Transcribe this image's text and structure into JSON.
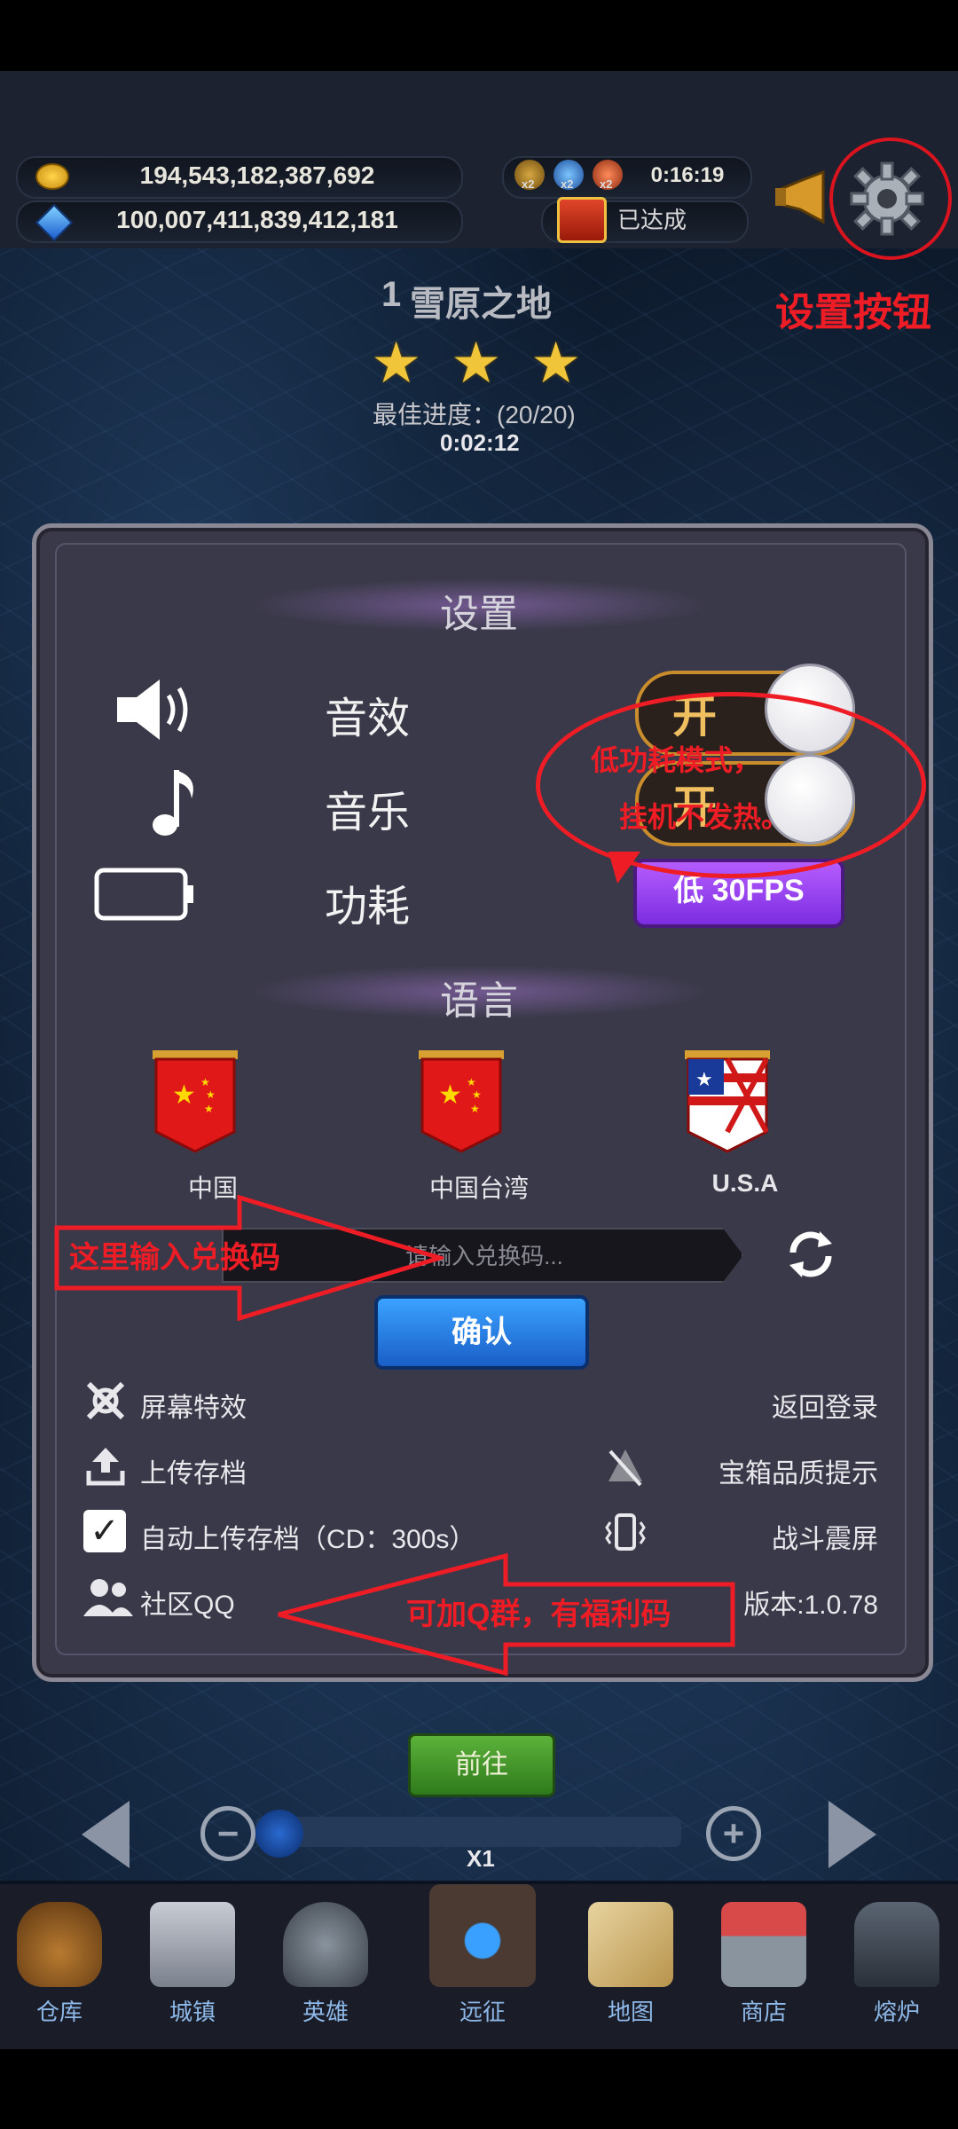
{
  "resources": {
    "gold": "194,543,182,387,692",
    "gems": "100,007,411,839,412,181"
  },
  "boosts": {
    "multipliers": [
      "x2",
      "x2",
      "x2"
    ],
    "timer": "0:16:19",
    "achievement": "已达成"
  },
  "annotations": {
    "settings_button": "设置按钮",
    "low_power": [
      "低功耗模式，",
      "挂机不发热。"
    ],
    "redeem_here": "这里输入兑换码",
    "qq_group": "可加Q群，有福利码"
  },
  "stage": {
    "number": "1",
    "name": "雪原之地",
    "best_progress": "最佳进度：(20/20)",
    "best_time": "0:02:12",
    "stars": 3
  },
  "settings": {
    "title": "设置",
    "sound_label": "音效",
    "sound_state": "开",
    "music_label": "音乐",
    "music_state": "开",
    "power_label": "功耗",
    "power_button": "低 30FPS",
    "language_title": "语言",
    "languages": [
      "中国",
      "中国台湾",
      "U.S.A"
    ],
    "redeem_placeholder": "请输入兑换码...",
    "confirm": "确认",
    "options_left": {
      "screen_effects": "屏幕特效",
      "upload_save": "上传存档",
      "auto_upload": "自动上传存档（CD：300s）",
      "community": "社区QQ"
    },
    "options_right": {
      "back_to_login": "返回登录",
      "chest_quality": "宝箱品质提示",
      "battle_shake": "战斗震屏",
      "version": "版本:1.0.78"
    }
  },
  "bottom": {
    "go_button": "前往",
    "speed": "X1",
    "nav": [
      "仓库",
      "城镇",
      "英雄",
      "远征",
      "地图",
      "商店",
      "熔炉"
    ]
  },
  "colors": {
    "annotation_red": "#ee1c25",
    "toggle_on_text": "#f0c060",
    "fps_button": "#9b45f0",
    "confirm_button": "#2a7ee8",
    "go_button": "#4a9a2e"
  }
}
